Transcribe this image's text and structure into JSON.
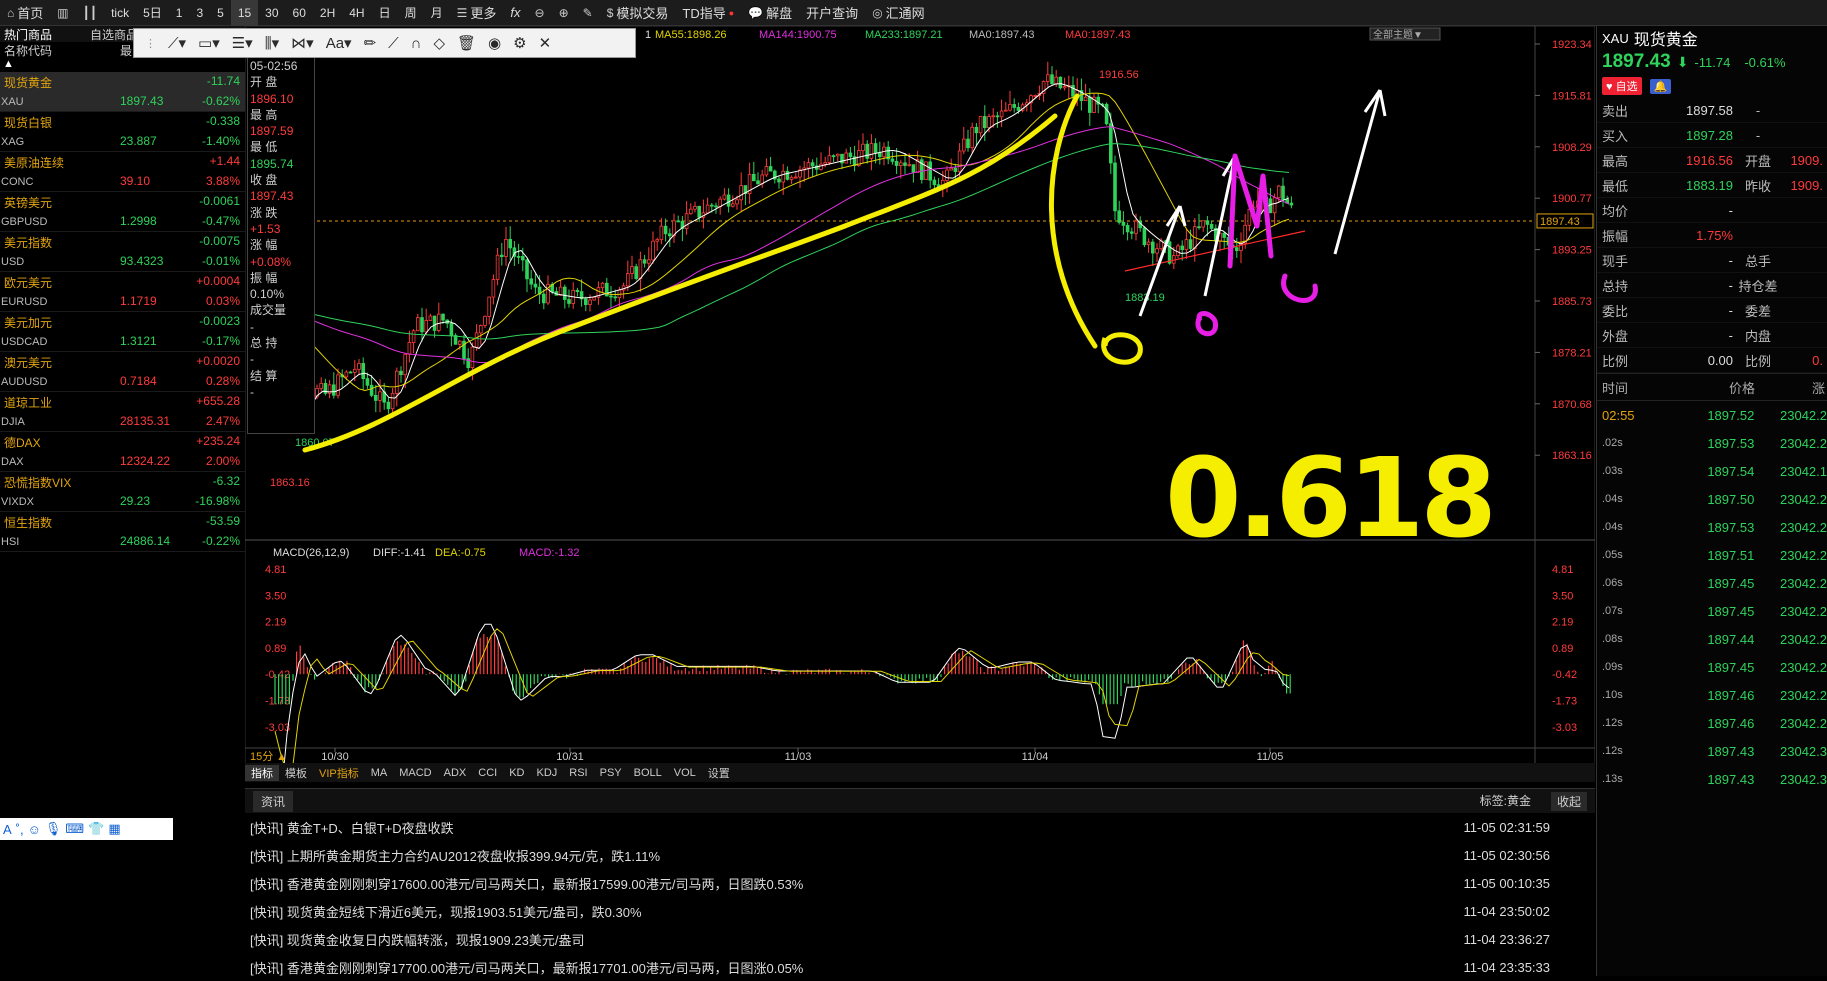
{
  "toolbar": {
    "items": [
      "首页",
      "",
      "tick",
      "5日",
      "1",
      "3",
      "5",
      "15",
      "30",
      "60",
      "2H",
      "4H",
      "日",
      "周",
      "月",
      "更多",
      "fx",
      "",
      "",
      "模拟交易",
      "TD指导",
      "解盘",
      "开户查询",
      "汇通网"
    ]
  },
  "left_panel": {
    "tabs": [
      "热门商品",
      "自选商品"
    ],
    "col_name": "名称代码",
    "col_hidden": "最",
    "rows": [
      {
        "name": "现货黄金",
        "code": "XAU",
        "chg": "-11.74",
        "price": "1897.43",
        "pct": "-0.62%",
        "dir": "down",
        "hl": true
      },
      {
        "name": "现货白银",
        "code": "XAG",
        "chg": "-0.338",
        "price": "23.887",
        "pct": "-1.40%",
        "dir": "down"
      },
      {
        "name": "美原油连续",
        "code": "CONC",
        "chg": "+1.44",
        "price": "39.10",
        "pct": "3.88%",
        "dir": "up"
      },
      {
        "name": "英镑美元",
        "code": "GBPUSD",
        "chg": "-0.0061",
        "price": "1.2998",
        "pct": "-0.47%",
        "dir": "down"
      },
      {
        "name": "美元指数",
        "code": "USD",
        "chg": "-0.0075",
        "price": "93.4323",
        "pct": "-0.01%",
        "dir": "down"
      },
      {
        "name": "欧元美元",
        "code": "EURUSD",
        "chg": "+0.0004",
        "price": "1.1719",
        "pct": "0.03%",
        "dir": "up"
      },
      {
        "name": "美元加元",
        "code": "USDCAD",
        "chg": "-0.0023",
        "price": "1.3121",
        "pct": "-0.17%",
        "dir": "down"
      },
      {
        "name": "澳元美元",
        "code": "AUDUSD",
        "chg": "+0.0020",
        "price": "0.7184",
        "pct": "0.28%",
        "dir": "up"
      },
      {
        "name": "道琼工业",
        "code": "DJIA",
        "chg": "+655.28",
        "price": "28135.31",
        "pct": "2.47%",
        "dir": "up"
      },
      {
        "name": "德DAX",
        "code": "DAX",
        "chg": "+235.24",
        "price": "12324.22",
        "pct": "2.00%",
        "dir": "up"
      },
      {
        "name": "恐慌指数VIX",
        "code": "VIXDX",
        "chg": "-6.32",
        "price": "29.23",
        "pct": "-16.98%",
        "dir": "down"
      },
      {
        "name": "恒生指数",
        "code": "HSI",
        "chg": "-53.59",
        "price": "24886.14",
        "pct": "-0.22%",
        "dir": "down"
      }
    ]
  },
  "info_box": {
    "date": "05-02:56",
    "open_label": "开 盘",
    "open": "1896.10",
    "high_label": "最 高",
    "high": "1897.59",
    "low_label": "最 低",
    "low": "1895.74",
    "close_label": "收 盘",
    "close": "1897.43",
    "chg_label": "涨 跌",
    "chg": "+1.53",
    "pct_label": "涨 幅",
    "pct": "+0.08%",
    "amp_label": "振 幅",
    "amp": "0.10%",
    "vol_label": "成交量",
    "vol": "-",
    "oi_label": "总 持",
    "oi": "-",
    "settle_label": "结 算",
    "settle": "-"
  },
  "ma_header": {
    "ma1": "1",
    "ma55": "MA55:1898.26",
    "ma144": "MA144:1900.75",
    "ma233": "MA233:1897.21",
    "ma0a": "MA0:1897.43",
    "ma0b": "MA0:1897.43",
    "theme": "全部主题▼"
  },
  "price_axis": [
    "1923.34",
    "1915.81",
    "1908.29",
    "1900.77",
    "1893.25",
    "1885.73",
    "1878.21",
    "1870.68",
    "1863.16"
  ],
  "current_price_tag": "1897.43",
  "left_axis_label": "1863.16",
  "hi_label": "1916.56",
  "lo_label": "1883.19",
  "low_label2": "1860.07",
  "macd_header": {
    "title": "MACD(26,12,9)",
    "diff": "DIFF:-1.41",
    "dea": "DEA:-0.75",
    "macd": "MACD:-1.32"
  },
  "macd_axis": [
    "4.81",
    "3.50",
    "2.19",
    "0.89",
    "-0.42",
    "-1.73",
    "-3.03"
  ],
  "x_axis": {
    "period": "15分 ▲",
    "labels": [
      "10/30",
      "10/31",
      "11/03",
      "11/04",
      "11/05"
    ]
  },
  "annotation": "0.618",
  "bottom_tabs": [
    "指标",
    "模板",
    "VIP指标",
    "MA",
    "MACD",
    "ADX",
    "CCI",
    "KD",
    "KDJ",
    "RSI",
    "PSY",
    "BOLL",
    "VOL",
    "设置"
  ],
  "news": {
    "title": "资讯",
    "tag": "标签:黄金",
    "collapse": "收起",
    "items": [
      {
        "text": "[快讯] 黄金T+D、白银T+D夜盘收跌",
        "time": "11-05 02:31:59"
      },
      {
        "text": "[快讯] 上期所黄金期货主力合约AU2012夜盘收报399.94元/克，跌1.11%",
        "time": "11-05 02:30:56"
      },
      {
        "text": "[快讯] 香港黄金刚刚刺穿17600.00港元/司马两关口，最新报17599.00港元/司马两，日图跌0.53%",
        "time": "11-05 00:10:35"
      },
      {
        "text": "[快讯] 现货黄金短线下滑近6美元，现报1903.51美元/盎司，跌0.30%",
        "time": "11-04 23:50:02"
      },
      {
        "text": "[快讯] 现货黄金收复日内跌幅转涨，现报1909.23美元/盎司",
        "time": "11-04 23:36:27"
      },
      {
        "text": "[快讯] 香港黄金刚刚刺穿17700.00港元/司马两关口，最新报17701.00港元/司马两，日图涨0.05%",
        "time": "11-04 23:35:33"
      }
    ]
  },
  "quote": {
    "code": "XAU",
    "name": "现货黄金",
    "price": "1897.43",
    "arrow": "⬇",
    "chg": "-11.74",
    "pct": "-0.61%",
    "fav": "♥ 自选",
    "rows": [
      [
        "卖出",
        "1897.58",
        "-",
        ""
      ],
      [
        "买入",
        "1897.28",
        "-",
        ""
      ],
      [
        "最高",
        "1916.56",
        "开盘",
        "1909."
      ],
      [
        "最低",
        "1883.19",
        "昨收",
        "1909."
      ],
      [
        "均价",
        "-",
        "",
        ""
      ],
      [
        "振幅",
        "1.75%",
        "",
        ""
      ],
      [
        "现手",
        "-",
        "总手",
        ""
      ],
      [
        "总持",
        "-",
        "持仓差",
        ""
      ],
      [
        "委比",
        "-",
        "委差",
        ""
      ],
      [
        "外盘",
        "-",
        "内盘",
        ""
      ],
      [
        "比例",
        "0.00",
        "比例",
        "0."
      ]
    ]
  },
  "ticks": {
    "hdr": [
      "时间",
      "价格",
      "涨"
    ],
    "rows": [
      [
        "02:55",
        "1897.52",
        "23042.2"
      ],
      [
        ".02s",
        "1897.53",
        "23042.2"
      ],
      [
        ".03s",
        "1897.54",
        "23042.1"
      ],
      [
        ".04s",
        "1897.50",
        "23042.2"
      ],
      [
        ".04s",
        "1897.53",
        "23042.2"
      ],
      [
        ".05s",
        "1897.51",
        "23042.2"
      ],
      [
        ".06s",
        "1897.45",
        "23042.2"
      ],
      [
        ".07s",
        "1897.45",
        "23042.2"
      ],
      [
        ".08s",
        "1897.44",
        "23042.2"
      ],
      [
        ".09s",
        "1897.45",
        "23042.2"
      ],
      [
        ".10s",
        "1897.46",
        "23042.2"
      ],
      [
        ".12s",
        "1897.46",
        "23042.2"
      ],
      [
        ".12s",
        "1897.43",
        "23042.3"
      ],
      [
        ".13s",
        "1897.43",
        "23042.3"
      ]
    ]
  }
}
